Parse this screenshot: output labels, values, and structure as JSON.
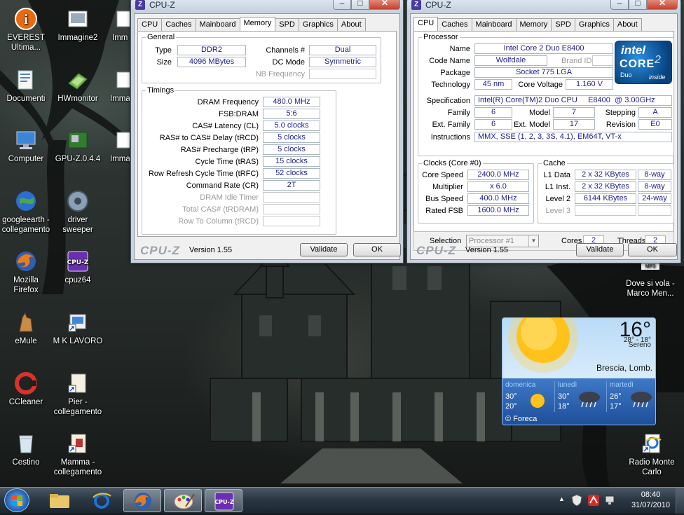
{
  "desktop_icons": [
    {
      "label": "EVEREST\nUltima...",
      "icon": "everest-icon"
    },
    {
      "label": "Immagine2",
      "icon": "image-icon"
    },
    {
      "label": "Imm",
      "icon": "image-icon"
    },
    {
      "label": "Documenti",
      "icon": "documents-icon"
    },
    {
      "label": "HWmonitor",
      "icon": "hwmonitor-icon"
    },
    {
      "label": "Imma",
      "icon": "image-icon"
    },
    {
      "label": "Computer",
      "icon": "computer-icon"
    },
    {
      "label": "GPU-Z.0.4.4",
      "icon": "gpuz-icon"
    },
    {
      "label": "Imma",
      "icon": "image-icon"
    },
    {
      "label": "googleearth -\ncollegamento",
      "icon": "googleearth-icon"
    },
    {
      "label": "driver\nsweeper",
      "icon": "driver-sweeper-icon"
    },
    {
      "label": "Mozilla\nFirefox",
      "icon": "firefox-icon"
    },
    {
      "label": "cpuz64",
      "icon": "cpuz-icon"
    },
    {
      "label": "eMule",
      "icon": "emule-icon"
    },
    {
      "label": "M K LAVORO",
      "icon": "shortcut-icon"
    },
    {
      "label": "CCleaner",
      "icon": "ccleaner-icon"
    },
    {
      "label": "Pier -\ncollegamento",
      "icon": "shortcut-icon"
    },
    {
      "label": "Cestino",
      "icon": "recycle-bin-icon"
    },
    {
      "label": "Mamma -\ncollegamento",
      "icon": "shortcut-icon"
    },
    {
      "label": "Dove si vola -\nMarco Men...",
      "icon": "mp3-icon"
    },
    {
      "label": "Radio Monte\nCarlo",
      "icon": "ie-shortcut-icon"
    }
  ],
  "mp3_badge": "MP3",
  "cpuz_memory": {
    "title": "CPU-Z",
    "tabs": [
      "CPU",
      "Caches",
      "Mainboard",
      "Memory",
      "SPD",
      "Graphics",
      "About"
    ],
    "active_tab": "Memory",
    "general_label": "General",
    "type_label": "Type",
    "type_value": "DDR2",
    "size_label": "Size",
    "size_value": "4096 MBytes",
    "channels_label": "Channels #",
    "channels_value": "Dual",
    "dcmode_label": "DC Mode",
    "dcmode_value": "Symmetric",
    "nbfreq_label": "NB Frequency",
    "timings_label": "Timings",
    "timings": [
      {
        "label": "DRAM Frequency",
        "value": "480.0 MHz"
      },
      {
        "label": "FSB:DRAM",
        "value": "5:6"
      },
      {
        "label": "CAS# Latency (CL)",
        "value": "5.0 clocks"
      },
      {
        "label": "RAS# to CAS# Delay (tRCD)",
        "value": "5 clocks"
      },
      {
        "label": "RAS# Precharge (tRP)",
        "value": "5 clocks"
      },
      {
        "label": "Cycle Time (tRAS)",
        "value": "15 clocks"
      },
      {
        "label": "Row Refresh Cycle Time (tRFC)",
        "value": "52 clocks"
      },
      {
        "label": "Command Rate (CR)",
        "value": "2T"
      },
      {
        "label": "DRAM Idle Timer",
        "value": ""
      },
      {
        "label": "Total CAS# (tRDRAM)",
        "value": ""
      },
      {
        "label": "Row To Column (tRCD)",
        "value": ""
      }
    ],
    "brand": "CPU-Z",
    "version": "Version 1.55",
    "validate": "Validate",
    "ok": "OK"
  },
  "cpuz_cpu": {
    "title": "CPU-Z",
    "tabs": [
      "CPU",
      "Caches",
      "Mainboard",
      "Memory",
      "SPD",
      "Graphics",
      "About"
    ],
    "active_tab": "CPU",
    "processor_label": "Processor",
    "name_label": "Name",
    "name_value": "Intel Core 2 Duo E8400",
    "codename_label": "Code Name",
    "codename_value": "Wolfdale",
    "brandid_label": "Brand ID",
    "package_label": "Package",
    "package_value": "Socket 775 LGA",
    "technology_label": "Technology",
    "technology_value": "45 nm",
    "corevoltage_label": "Core Voltage",
    "corevoltage_value": "1.160 V",
    "spec_label": "Specification",
    "spec_value": "Intel(R) Core(TM)2 Duo CPU     E8400  @ 3.00GHz",
    "family_label": "Family",
    "family_value": "6",
    "model_label": "Model",
    "model_value": "7",
    "stepping_label": "Stepping",
    "stepping_value": "A",
    "extfamily_label": "Ext. Family",
    "extfamily_value": "6",
    "extmodel_label": "Ext. Model",
    "extmodel_value": "17",
    "revision_label": "Revision",
    "revision_value": "E0",
    "instructions_label": "Instructions",
    "instructions_value": "MMX, SSE (1, 2, 3, 3S, 4.1), EM64T, VT-x",
    "intel_brand": "intel",
    "intel_core": "CORE",
    "intel_sup": "2",
    "intel_duo": "Duo",
    "intel_inside": "inside",
    "clocks_label": "Clocks (Core #0)",
    "corespeed_label": "Core Speed",
    "corespeed_value": "2400.0 MHz",
    "multiplier_label": "Multiplier",
    "multiplier_value": "x 6.0",
    "busspeed_label": "Bus Speed",
    "busspeed_value": "400.0 MHz",
    "ratedfsb_label": "Rated FSB",
    "ratedfsb_value": "1600.0 MHz",
    "cache_label": "Cache",
    "cache": [
      {
        "label": "L1 Data",
        "size": "2 x 32 KBytes",
        "way": "8-way"
      },
      {
        "label": "L1 Inst.",
        "size": "2 x 32 KBytes",
        "way": "8-way"
      },
      {
        "label": "Level 2",
        "size": "6144 KBytes",
        "way": "24-way"
      },
      {
        "label": "Level 3",
        "size": "",
        "way": ""
      }
    ],
    "selection_label": "Selection",
    "selection_value": "Processor #1",
    "cores_label": "Cores",
    "cores_value": "2",
    "threads_label": "Threads",
    "threads_value": "2",
    "brand": "CPU-Z",
    "version": "Version 1.55",
    "validate": "Validate",
    "ok": "OK"
  },
  "weather": {
    "temp": "16°",
    "range": "28° - 18°",
    "condition": "Sereno",
    "location": "Brescia, Lomb.",
    "forecast": [
      {
        "day": "domenica",
        "high": "30°",
        "low": "20°",
        "icon": "sun-icon"
      },
      {
        "day": "lunedì",
        "high": "30°",
        "low": "18°",
        "icon": "storm-icon"
      },
      {
        "day": "martedì",
        "high": "26°",
        "low": "17°",
        "icon": "storm-icon"
      }
    ],
    "credit": "© Foreca"
  },
  "taskbar": {
    "time": "08:40",
    "date": "31/07/2010"
  }
}
